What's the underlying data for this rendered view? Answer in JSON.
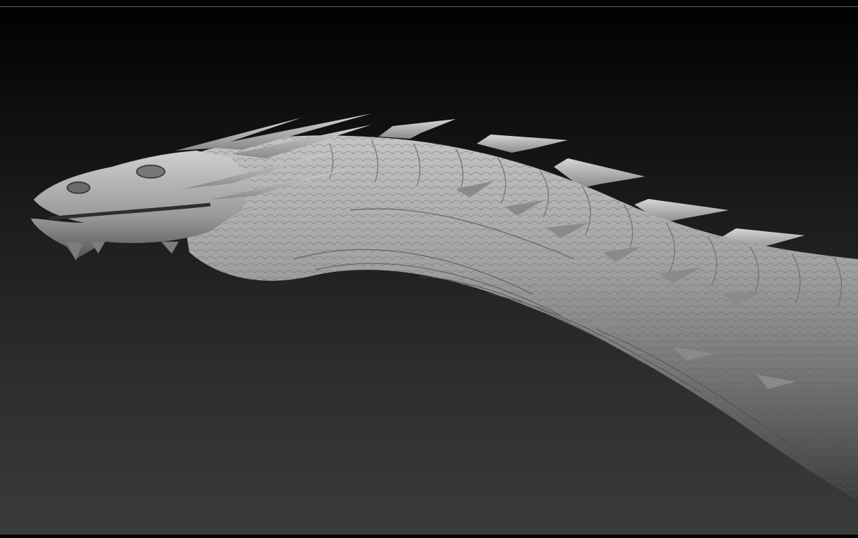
{
  "canvas": {
    "background_top": "#000000",
    "background_bottom": "#3b3b3b",
    "material_color": "#8e8e8e",
    "material_highlight": "#c9c9c9",
    "material_shadow": "#3a3a3a"
  },
  "model": {
    "icon": "dragon-sculpt"
  }
}
